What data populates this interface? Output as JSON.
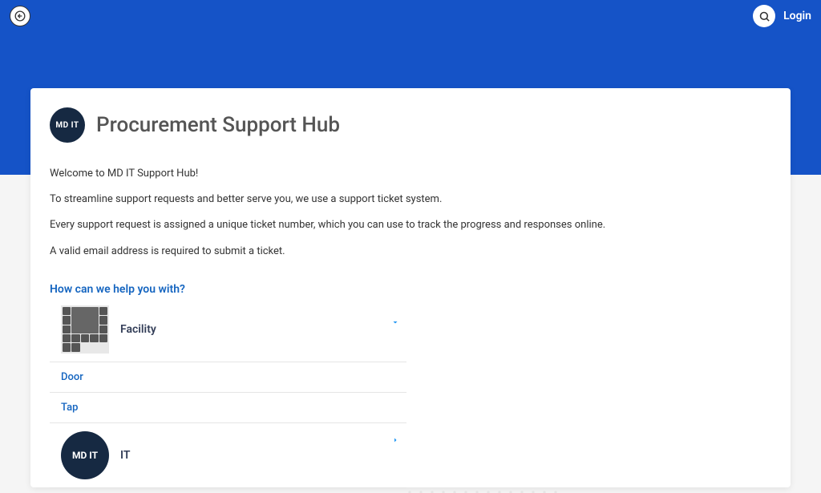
{
  "nav": {
    "login_label": "Login"
  },
  "page": {
    "title": "Procurement Support Hub",
    "logo_text": "MD IT"
  },
  "intro": {
    "p1": "Welcome to MD IT Support Hub!",
    "p2": "To streamline support requests and better serve you, we use a support ticket system.",
    "p3": "Every support request is assigned a unique ticket number, which you can use to track the progress and responses online.",
    "p4": "A valid email address is required to submit a ticket."
  },
  "help": {
    "heading": "How can we help you with?",
    "categories": [
      {
        "label": "Facility",
        "expanded": true,
        "children": [
          {
            "label": "Door"
          },
          {
            "label": "Tap"
          }
        ]
      },
      {
        "label": "IT",
        "expanded": false
      }
    ]
  }
}
